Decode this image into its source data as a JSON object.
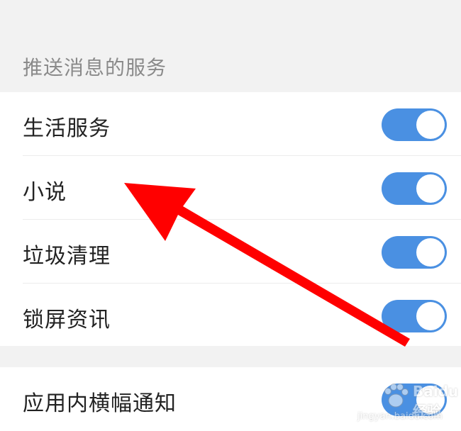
{
  "section": {
    "title": "推送消息的服务"
  },
  "services": [
    {
      "label": "生活服务",
      "enabled": true
    },
    {
      "label": "小说",
      "enabled": true
    },
    {
      "label": "垃圾清理",
      "enabled": true
    },
    {
      "label": "锁屏资讯",
      "enabled": true
    }
  ],
  "banner": {
    "label": "应用内横幅通知",
    "enabled": true
  },
  "colors": {
    "toggle_on": "#4a90e2",
    "annotation_arrow": "#ff0000"
  },
  "watermark": {
    "brand": "Baidu经验",
    "url": "jingyan.baidu.com"
  }
}
